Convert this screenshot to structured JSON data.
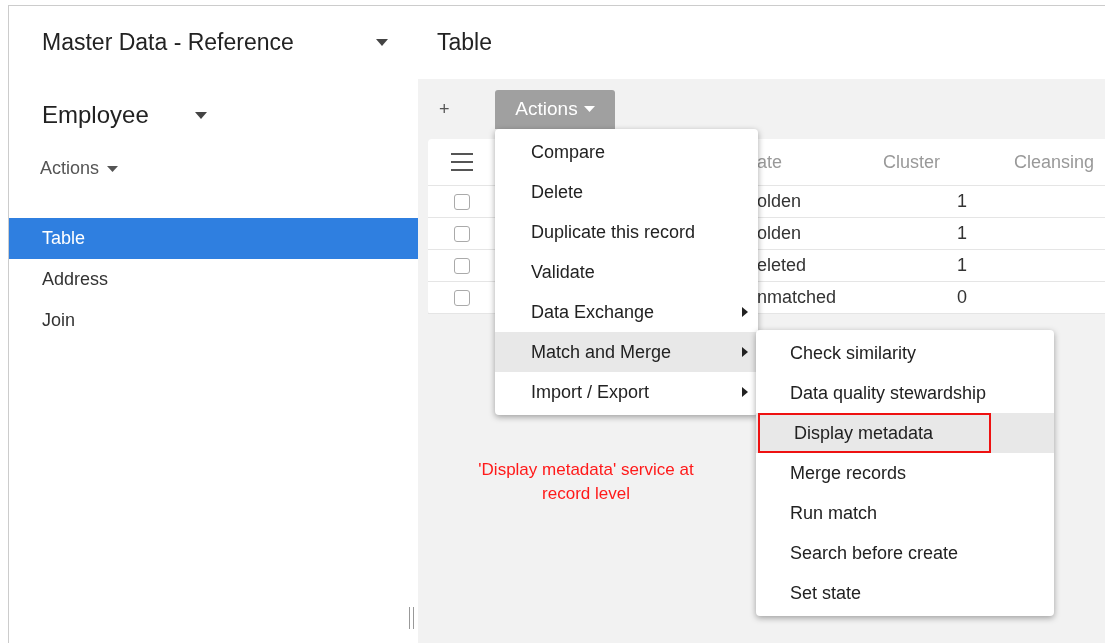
{
  "header": {
    "app_title": "Master Data - Reference",
    "page_title": "Table"
  },
  "sidebar": {
    "entity": "Employee",
    "actions": "Actions",
    "items": [
      {
        "label": "Table",
        "selected": true
      },
      {
        "label": "Address",
        "selected": false
      },
      {
        "label": "Join",
        "selected": false
      }
    ]
  },
  "toolbar": {
    "add": "+",
    "actions": "Actions"
  },
  "table": {
    "columns": [
      "ate",
      "Cluster",
      "Cleansing"
    ],
    "rows": [
      {
        "checked": false,
        "state": "olden",
        "cluster": "1"
      },
      {
        "checked": false,
        "state": "olden",
        "cluster": "1"
      },
      {
        "checked": false,
        "state": "eleted",
        "cluster": "1"
      },
      {
        "checked": false,
        "state": "nmatched",
        "cluster": "0"
      }
    ]
  },
  "actions_menu": [
    {
      "label": "Compare",
      "submenu": false,
      "selected": false
    },
    {
      "label": "Delete",
      "submenu": false,
      "selected": false
    },
    {
      "label": "Duplicate this record",
      "submenu": false,
      "selected": false
    },
    {
      "label": "Validate",
      "submenu": false,
      "selected": false
    },
    {
      "label": "Data Exchange",
      "submenu": true,
      "selected": false
    },
    {
      "label": "Match and Merge",
      "submenu": true,
      "selected": true
    },
    {
      "label": "Import / Export",
      "submenu": true,
      "selected": false
    }
  ],
  "submenu": [
    {
      "label": "Check similarity",
      "selected": false,
      "highlighted": false
    },
    {
      "label": "Data quality stewardship",
      "selected": false,
      "highlighted": false
    },
    {
      "label": "Display metadata",
      "selected": true,
      "highlighted": true
    },
    {
      "label": "Merge records",
      "selected": false,
      "highlighted": false
    },
    {
      "label": "Run match",
      "selected": false,
      "highlighted": false
    },
    {
      "label": "Search before create",
      "selected": false,
      "highlighted": false
    },
    {
      "label": "Set state",
      "selected": false,
      "highlighted": false
    }
  ],
  "annotation": "'Display metadata' service at record level"
}
